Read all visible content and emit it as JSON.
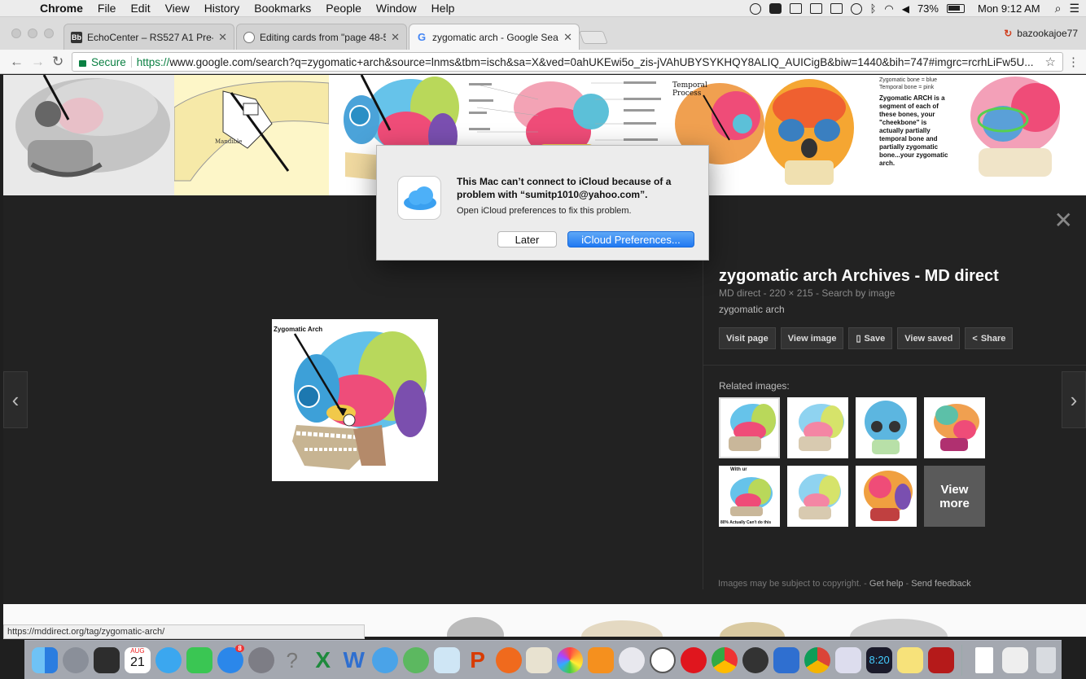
{
  "menubar": {
    "app": "Chrome",
    "items": [
      "File",
      "Edit",
      "View",
      "History",
      "Bookmarks",
      "People",
      "Window",
      "Help"
    ],
    "battery": "73%",
    "clock": "Mon 9:12 AM"
  },
  "tabs": [
    {
      "title": "EchoCenter – RS527 A1 Pre-D",
      "fav": "Bb"
    },
    {
      "title": "Editing cards from \"page 48-5",
      "fav": ""
    },
    {
      "title": "zygomatic arch - Google Searc",
      "fav": "G"
    }
  ],
  "profile": "bazookajoe77",
  "omnibox": {
    "secure": "Secure",
    "scheme": "https://",
    "url": "www.google.com/search?q=zygomatic+arch&source=lnms&tbm=isch&sa=X&ved=0ahUKEwi5o_zis-jVAhUBYSYKHQY8ALIQ_AUICigB&biw=1440&bih=747#imgrc=rcrhLiFw5U..."
  },
  "strip_labels": {
    "mandible": "Mandible",
    "temporal_process": "Temporal Process",
    "zygomatic_bone": "Zygomatic bone = blue",
    "temporal_bone": "Temporal bone = pink",
    "zygomatic_arch_text": "Zygomatic ARCH is a segment of each of these bones, your \"cheekbone\" is actually partially temporal bone and partially zygomatic bone...your zygomatic arch."
  },
  "viewer": {
    "main_caption": "Zygomatic Arch",
    "title": "zygomatic arch Archives - MD direct",
    "meta": "MD direct - 220 × 215 - Search by image",
    "desc": "zygomatic arch",
    "buttons": {
      "visit": "Visit page",
      "view": "View image",
      "save": "Save",
      "saved": "View saved",
      "share": "Share"
    },
    "related": "Related images:",
    "rel_top_text": "With ur",
    "rel_bottom_text": "80% Actually Can't do this",
    "view_more_1": "View",
    "view_more_2": "more",
    "footer_note": "Images may be subject to copyright.",
    "help": "Get help",
    "feedback": "Send feedback"
  },
  "dialog": {
    "line1": "This Mac can’t connect to iCloud because of a problem with “sumitp1010@yahoo.com”.",
    "line2": "Open iCloud preferences to fix this problem.",
    "later": "Later",
    "prefs": "iCloud Preferences..."
  },
  "status_url": "https://mddirect.org/tag/zygomatic-arch/",
  "dock": {
    "calendar_month": "AUG",
    "calendar_day": "21",
    "appstore_badge": "8",
    "clock_text": "8:20"
  },
  "colors": {
    "secure_green": "#0b8043",
    "blue_button": "#2079f2"
  }
}
